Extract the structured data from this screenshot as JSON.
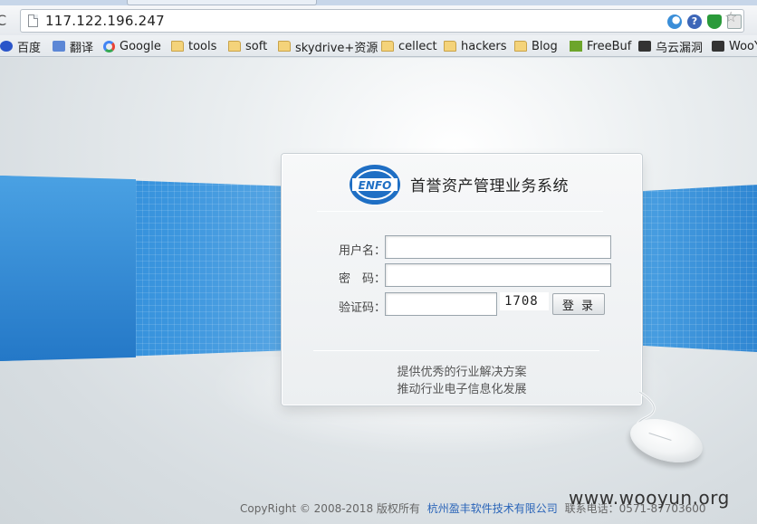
{
  "browser": {
    "url": "117.122.196.247",
    "reload_icon": "C",
    "extension_icons": [
      "moon-icon",
      "help-icon",
      "shield-icon",
      "page-action-icon"
    ],
    "star_icon": "☆",
    "ext2_glyph": "?"
  },
  "bookmarks": [
    {
      "label": "百度",
      "icon": "baidu-paw-icon"
    },
    {
      "label": "翻译",
      "icon": "translate-icon"
    },
    {
      "label": "Google",
      "icon": "google-icon"
    },
    {
      "label": "tools",
      "icon": "folder-icon"
    },
    {
      "label": "soft",
      "icon": "folder-icon"
    },
    {
      "label": "skydrive+资源",
      "icon": "folder-icon"
    },
    {
      "label": "cellect",
      "icon": "folder-icon"
    },
    {
      "label": "hackers",
      "icon": "folder-icon"
    },
    {
      "label": "Blog",
      "icon": "folder-icon"
    },
    {
      "label": "FreeBuf",
      "icon": "freebuf-icon"
    },
    {
      "label": "乌云漏洞",
      "icon": "wooyun-icon"
    },
    {
      "label": "WooY",
      "icon": "wooyun-icon"
    }
  ],
  "login": {
    "logo_text": "ENFO",
    "title": "首誉资产管理业务系统",
    "username_label": "用户名：",
    "password_label": "密　码：",
    "captcha_label": "验证码：",
    "username_value": "",
    "password_value": "",
    "captcha_value": "",
    "captcha_code": "1708",
    "submit_label": "登 录",
    "slogan_line1": "提供优秀的行业解决方案",
    "slogan_line2": "推动行业电子信息化发展"
  },
  "footer": {
    "copyright": "CopyRight © 2008-2018 版权所有",
    "company": "杭州盈丰软件技术有限公司",
    "contact": "联系电话：0571-87703600"
  },
  "watermark": "www.wooyun.org",
  "colors": {
    "accent_blue": "#2d86d4",
    "link_blue": "#2a64b8"
  }
}
